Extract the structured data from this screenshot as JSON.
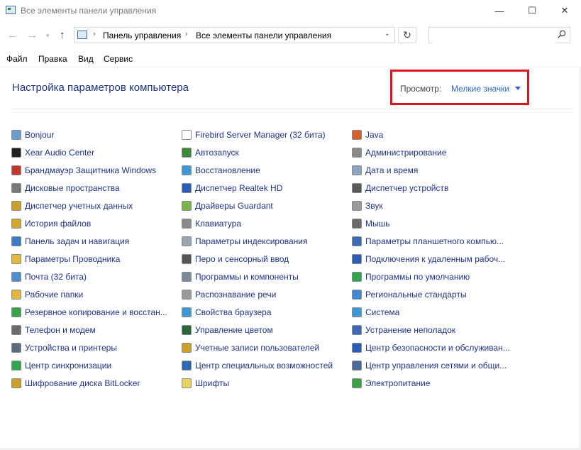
{
  "window": {
    "title": "Все элементы панели управления",
    "controls": [
      "—",
      "☐",
      "✕"
    ]
  },
  "address": {
    "breadcrumbs": [
      "Панель управления",
      "Все элементы панели управления"
    ],
    "search_placeholder": ""
  },
  "menu": [
    "Файл",
    "Правка",
    "Вид",
    "Сервис"
  ],
  "header": {
    "title": "Настройка параметров компьютера",
    "view_label": "Просмотр:",
    "view_value": "Мелкие значки"
  },
  "columns": [
    [
      {
        "label": "Bonjour",
        "icon": "bonjour-icon",
        "color": "#6a9fd4"
      },
      {
        "label": "Xear Audio Center",
        "icon": "audio-center-icon",
        "color": "#222222"
      },
      {
        "label": "Брандмауэр Защитника Windows",
        "icon": "firewall-icon",
        "color": "#c0392b"
      },
      {
        "label": "Дисковые пространства",
        "icon": "storage-spaces-icon",
        "color": "#7a7a7a"
      },
      {
        "label": "Диспетчер учетных данных",
        "icon": "credential-manager-icon",
        "color": "#c9a227"
      },
      {
        "label": "История файлов",
        "icon": "file-history-icon",
        "color": "#d4a82a"
      },
      {
        "label": "Панель задач и навигация",
        "icon": "taskbar-icon",
        "color": "#3a7dc9"
      },
      {
        "label": "Параметры Проводника",
        "icon": "explorer-options-icon",
        "color": "#e2b93b"
      },
      {
        "label": "Почта (32 бита)",
        "icon": "mail-icon",
        "color": "#4f8fd1"
      },
      {
        "label": "Рабочие папки",
        "icon": "work-folders-icon",
        "color": "#e2b93b"
      },
      {
        "label": "Резервное копирование и восстан...",
        "icon": "backup-icon",
        "color": "#3aa34a"
      },
      {
        "label": "Телефон и модем",
        "icon": "phone-modem-icon",
        "color": "#6b6b6b"
      },
      {
        "label": "Устройства и принтеры",
        "icon": "devices-printers-icon",
        "color": "#5a6b7a"
      },
      {
        "label": "Центр синхронизации",
        "icon": "sync-center-icon",
        "color": "#2fa84f"
      },
      {
        "label": "Шифрование диска BitLocker",
        "icon": "bitlocker-icon",
        "color": "#c9a227"
      }
    ],
    [
      {
        "label": "Firebird Server Manager (32 бита)",
        "icon": "document-icon",
        "color": "#ffffff"
      },
      {
        "label": "Автозапуск",
        "icon": "autoplay-icon",
        "color": "#3a8a3a"
      },
      {
        "label": "Восстановление",
        "icon": "recovery-icon",
        "color": "#3a9ad4"
      },
      {
        "label": "Диспетчер Realtek HD",
        "icon": "realtek-icon",
        "color": "#2a5cb8"
      },
      {
        "label": "Драйверы Guardant",
        "icon": "guardant-icon",
        "color": "#7ab648"
      },
      {
        "label": "Клавиатура",
        "icon": "keyboard-icon",
        "color": "#8a8a8a"
      },
      {
        "label": "Параметры индексирования",
        "icon": "indexing-icon",
        "color": "#9aa4b0"
      },
      {
        "label": "Перо и сенсорный ввод",
        "icon": "pen-icon",
        "color": "#555555"
      },
      {
        "label": "Программы и компоненты",
        "icon": "programs-icon",
        "color": "#7a8a9a"
      },
      {
        "label": "Распознавание речи",
        "icon": "microphone-icon",
        "color": "#9a9a9a"
      },
      {
        "label": "Свойства браузера",
        "icon": "internet-options-icon",
        "color": "#3a9ad4"
      },
      {
        "label": "Управление цветом",
        "icon": "color-management-icon",
        "color": "#2a6a3a"
      },
      {
        "label": "Учетные записи пользователей",
        "icon": "user-accounts-icon",
        "color": "#c9a227"
      },
      {
        "label": "Центр специальных возможностей",
        "icon": "accessibility-icon",
        "color": "#2a6ab8"
      },
      {
        "label": "Шрифты",
        "icon": "fonts-icon",
        "color": "#e8d45a"
      }
    ],
    [
      {
        "label": "Java",
        "icon": "java-icon",
        "color": "#d4622a"
      },
      {
        "label": "Администрирование",
        "icon": "administrative-tools-icon",
        "color": "#8a8a8a"
      },
      {
        "label": "Дата и время",
        "icon": "date-time-icon",
        "color": "#8aa4c4"
      },
      {
        "label": "Диспетчер устройств",
        "icon": "device-manager-icon",
        "color": "#5a5a5a"
      },
      {
        "label": "Звук",
        "icon": "sound-icon",
        "color": "#9a9a9a"
      },
      {
        "label": "Мышь",
        "icon": "mouse-icon",
        "color": "#6a6a6a"
      },
      {
        "label": "Параметры планшетного компью...",
        "icon": "tablet-icon",
        "color": "#3a6ab8"
      },
      {
        "label": "Подключения к удаленным рабоч...",
        "icon": "remote-desktop-icon",
        "color": "#2a5cb8"
      },
      {
        "label": "Программы по умолчанию",
        "icon": "default-programs-icon",
        "color": "#2fa84f"
      },
      {
        "label": "Региональные стандарты",
        "icon": "region-icon",
        "color": "#3a8ad4"
      },
      {
        "label": "Система",
        "icon": "system-icon",
        "color": "#3a9ad4"
      },
      {
        "label": "Устранение неполадок",
        "icon": "troubleshooting-icon",
        "color": "#3a6ab8"
      },
      {
        "label": "Центр безопасности и обслуживан...",
        "icon": "security-flag-icon",
        "color": "#2a5cb8"
      },
      {
        "label": "Центр управления сетями и общи...",
        "icon": "network-icon",
        "color": "#4a6a9a"
      },
      {
        "label": "Электропитание",
        "icon": "power-options-icon",
        "color": "#3aa34a"
      }
    ]
  ]
}
